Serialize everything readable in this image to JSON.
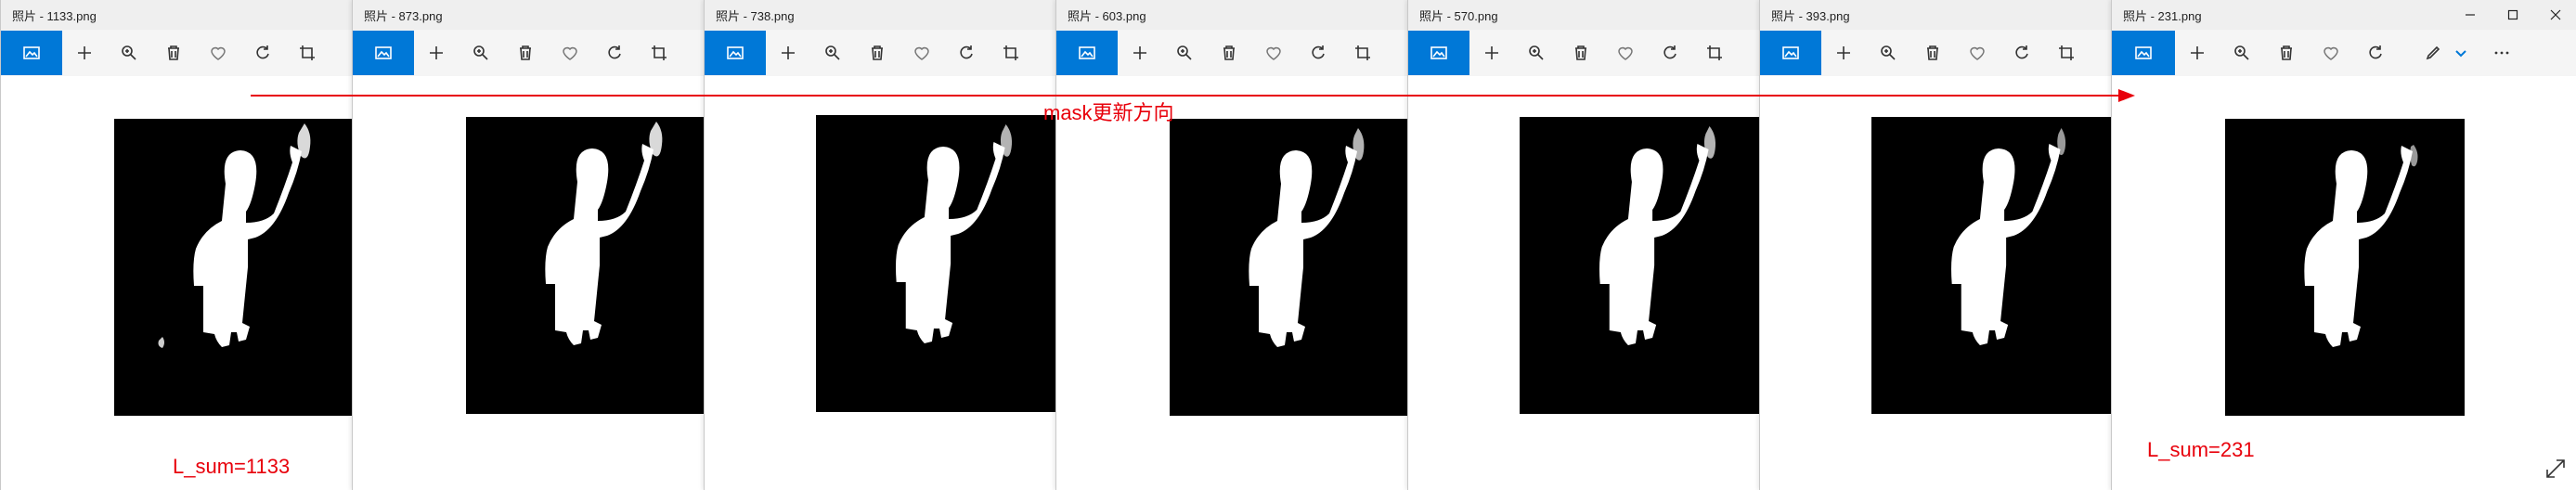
{
  "windows": [
    {
      "title": "照片 - 1133.png",
      "caption": "L_sum=1133"
    },
    {
      "title": "照片 - 873.png"
    },
    {
      "title": "照片 - 738.png"
    },
    {
      "title": "照片 - 603.png"
    },
    {
      "title": "照片 - 570.png"
    },
    {
      "title": "照片 - 393.png"
    },
    {
      "title": "照片 - 231.png",
      "caption": "L_sum=231"
    }
  ],
  "annotation": {
    "label": "mask更新方向",
    "color": "#e8000b"
  },
  "toolbar_icons": [
    "view-photo-icon",
    "add-icon",
    "zoom-icon",
    "delete-icon",
    "favorite-icon",
    "rotate-icon",
    "crop-icon"
  ],
  "accent": "#0078d7"
}
